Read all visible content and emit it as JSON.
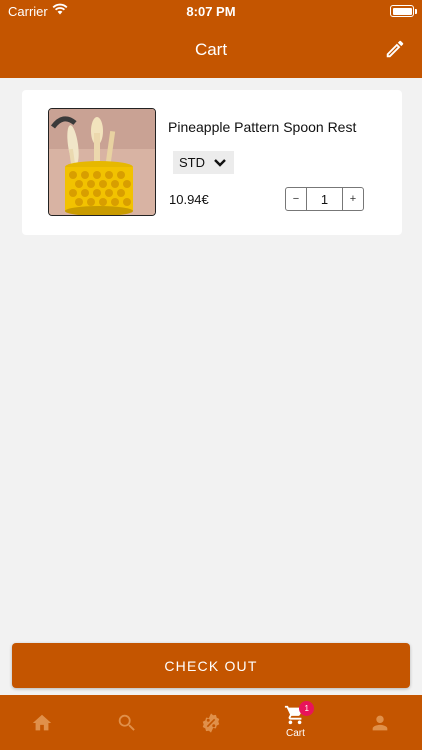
{
  "status_bar": {
    "carrier": "Carrier",
    "time": "8:07 PM"
  },
  "header": {
    "title": "Cart",
    "edit_icon": "pencil-icon"
  },
  "cart_items": [
    {
      "name": "Pineapple Pattern Spoon Rest",
      "variant": "STD",
      "price": "10.94€",
      "quantity": "1",
      "decrement_label": "−",
      "increment_label": "+"
    }
  ],
  "checkout": {
    "label": "CHECK OUT"
  },
  "tabbar": {
    "items": [
      {
        "icon": "home-icon",
        "label": ""
      },
      {
        "icon": "search-icon",
        "label": ""
      },
      {
        "icon": "discount-badge-icon",
        "label": ""
      },
      {
        "icon": "cart-icon",
        "label": "Cart",
        "badge": "1",
        "active": true
      },
      {
        "icon": "person-icon",
        "label": ""
      }
    ]
  },
  "colors": {
    "brand": "#c45500",
    "badge": "#e8145a",
    "background": "#f2f2f2"
  }
}
